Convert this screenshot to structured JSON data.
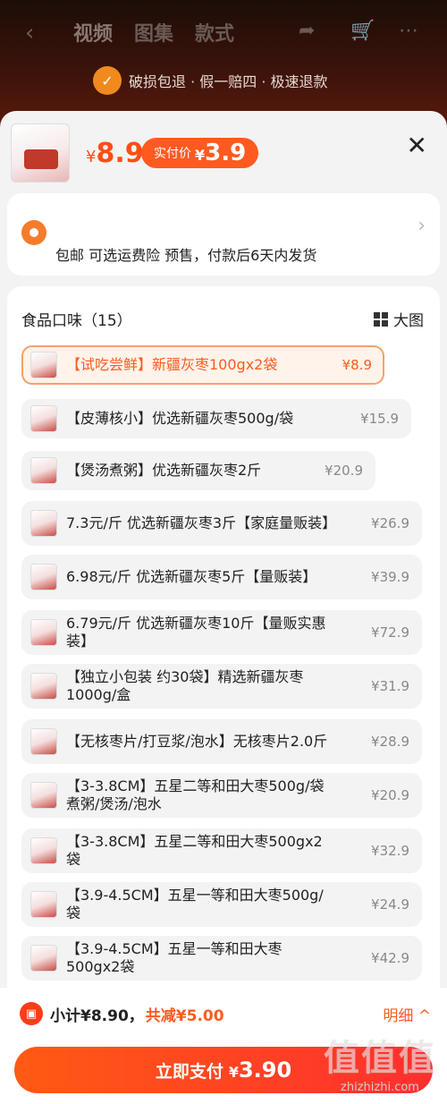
{
  "nav": {
    "back_icon": "chevron-left-icon",
    "tabs": [
      "视频",
      "图集",
      "款式"
    ],
    "share_icon": "share-icon",
    "cart_icon": "cart-icon",
    "more_icon": "more-icon"
  },
  "guarantee": {
    "icon": "shield-check-icon",
    "text": "破损包退 · 假一赔四 · 极速退款"
  },
  "header": {
    "price_symbol": "¥",
    "price": "8.9",
    "paid_label": "实付价",
    "paid_symbol": "¥",
    "paid_value": "3.9",
    "close_icon": "close-icon"
  },
  "shipping": {
    "icon": "location-pin-icon",
    "text": "包邮  可选运费险  预售，付款后6天内发货",
    "arrow_icon": "chevron-right-icon"
  },
  "options": {
    "title": "食品口味（15）",
    "view_toggle": "大图",
    "items": [
      {
        "name": "【试吃尝鲜】新疆灰枣100gx2袋",
        "price": "¥8.9",
        "selected": true
      },
      {
        "name": "【皮薄核小】优选新疆灰枣500g/袋",
        "price": "¥15.9",
        "selected": false
      },
      {
        "name": "【煲汤煮粥】优选新疆灰枣2斤",
        "price": "¥20.9",
        "selected": false
      },
      {
        "name": "7.3元/斤 优选新疆灰枣3斤【家庭量贩装】",
        "price": "¥26.9",
        "selected": false
      },
      {
        "name": "6.98元/斤 优选新疆灰枣5斤【量贩装】",
        "price": "¥39.9",
        "selected": false
      },
      {
        "name": "6.79元/斤 优选新疆灰枣10斤【量贩实惠装】",
        "price": "¥72.9",
        "selected": false
      },
      {
        "name": "【独立小包装 约30袋】精选新疆灰枣1000g/盒",
        "price": "¥31.9",
        "selected": false
      },
      {
        "name": "【无核枣片/打豆浆/泡水】无核枣片2.0斤",
        "price": "¥28.9",
        "selected": false
      },
      {
        "name": "【3-3.8CM】五星二等和田大枣500g/袋 煮粥/煲汤/泡水",
        "price": "¥20.9",
        "selected": false
      },
      {
        "name": "【3-3.8CM】五星二等和田大枣500gx2袋",
        "price": "¥32.9",
        "selected": false
      },
      {
        "name": "【3.9-4.5CM】五星一等和田大枣500g/袋",
        "price": "¥24.9",
        "selected": false
      },
      {
        "name": "【3.9-4.5CM】五星一等和田大枣500gx2袋",
        "price": "¥42.9",
        "selected": false
      }
    ]
  },
  "footer": {
    "coupon_icon": "coupon-icon",
    "subtotal": "小计¥8.90，",
    "reduction": "共减¥5.00",
    "detail": "明细 ^",
    "pay_label": "立即支付",
    "pay_symbol": "¥",
    "pay_amount": "3.90"
  },
  "watermark": {
    "big": "值值值",
    "small": "zhizhizhi.com"
  },
  "colors": {
    "accent": "#ff5a1f",
    "selected_border": "#f6a169",
    "option_bg": "#f3f3f3"
  }
}
